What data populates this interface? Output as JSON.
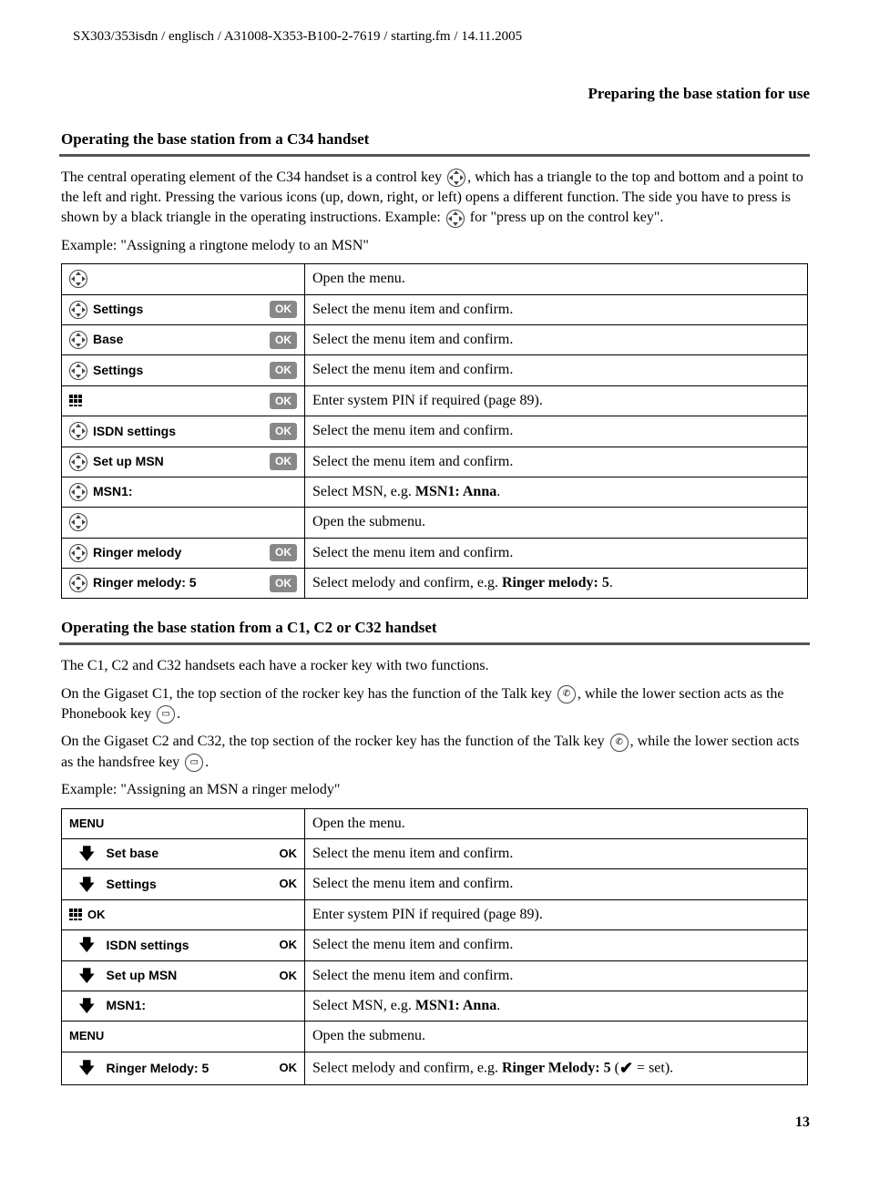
{
  "header_path": "SX303/353isdn / englisch / A31008-X353-B100-2-7619 / starting.fm / 14.11.2005",
  "right_title": "Preparing the base station for use",
  "section1": {
    "heading": "Operating the base station from a C34 handset",
    "para1_a": "The central operating element of the C34 handset is a control key ",
    "para1_b": ", which has a triangle to the top and bottom and a point to the left and right. Pressing the various icons (up, down, right, or left) opens a different function. The side you have to press is shown by a black triangle in the operating instructions. Example: ",
    "para1_c": " for \"press up on the control key\".",
    "example_label": "Example: \"Assigning a ringtone melody to an MSN\"",
    "rows": [
      {
        "icon": "ctrl",
        "item": "",
        "ok": "",
        "desc": "Open the menu."
      },
      {
        "icon": "ctrl",
        "item": "Settings",
        "ok": "pill",
        "desc": "Select the menu item and confirm."
      },
      {
        "icon": "ctrl",
        "item": "Base",
        "ok": "pill",
        "desc": "Select the menu item and confirm."
      },
      {
        "icon": "ctrl",
        "item": "Settings",
        "ok": "pill",
        "desc": "Select the menu item and confirm."
      },
      {
        "icon": "keypad",
        "item": "",
        "ok": "pill",
        "desc": "Enter system PIN if required (page 89)."
      },
      {
        "icon": "ctrl",
        "item": "ISDN settings",
        "ok": "pill",
        "desc": "Select the menu item and confirm."
      },
      {
        "icon": "ctrl",
        "item": "Set up MSN",
        "ok": "pill",
        "desc": "Select the menu item and confirm."
      },
      {
        "icon": "ctrl",
        "item": "MSN1:",
        "ok": "",
        "desc_pre": "Select MSN, e.g. ",
        "desc_bold": "MSN1: Anna",
        "desc_post": "."
      },
      {
        "icon": "ctrl",
        "item": "",
        "ok": "",
        "desc": "Open the submenu."
      },
      {
        "icon": "ctrl",
        "item": "Ringer melody",
        "ok": "pill",
        "desc": "Select the menu item and confirm."
      },
      {
        "icon": "ctrl",
        "item": "Ringer melody: 5",
        "ok": "pill",
        "desc_pre": "Select melody and confirm, e.g. ",
        "desc_bold": "Ringer melody: 5",
        "desc_post": "."
      }
    ]
  },
  "section2": {
    "heading": "Operating the base station from a C1, C2 or C32 handset",
    "para1": "The C1, C2 and C32 handsets each have a rocker key with two functions.",
    "para2_a": "On the Gigaset C1, the top section of the rocker key has the function of the Talk key ",
    "para2_b": ", while the lower section acts as the Phonebook key ",
    "para2_c": ".",
    "para3_a": "On the Gigaset C2 and C32, the top section of the rocker key has the function of the Talk key ",
    "para3_b": ", while the lower section acts as the handsfree key ",
    "para3_c": ".",
    "example_label": "Example: \"Assigning an MSN a ringer melody\"",
    "rows": [
      {
        "icon": "menu",
        "item": "",
        "ok": "",
        "desc": "Open the menu."
      },
      {
        "icon": "down",
        "item": "Set base",
        "ok": "plain",
        "desc": "Select the menu item and confirm."
      },
      {
        "icon": "down",
        "item": "Settings",
        "ok": "plain",
        "desc": "Select the menu item and confirm."
      },
      {
        "icon": "keypad",
        "item": "",
        "ok": "plain_after_keypad",
        "desc": "Enter system PIN if required (page 89)."
      },
      {
        "icon": "down",
        "item": "ISDN settings",
        "ok": "plain",
        "desc": "Select the menu item and confirm."
      },
      {
        "icon": "down",
        "item": "Set up MSN",
        "ok": "plain",
        "desc": "Select the menu item and confirm."
      },
      {
        "icon": "down",
        "item": "MSN1:",
        "ok": "",
        "desc_pre": "Select MSN, e.g. ",
        "desc_bold": "MSN1: Anna",
        "desc_post": "."
      },
      {
        "icon": "menu",
        "item": "",
        "ok": "",
        "desc": "Open the submenu."
      },
      {
        "icon": "down",
        "item": "Ringer Melody: 5",
        "ok": "plain",
        "desc_pre": "Select melody and confirm, e.g. ",
        "desc_bold": "Ringer Melody: 5",
        "desc_post_check": " = set).",
        "check_prefix": " ("
      }
    ]
  },
  "ok_label": "OK",
  "menu_label": "MENU",
  "page_number": "13"
}
